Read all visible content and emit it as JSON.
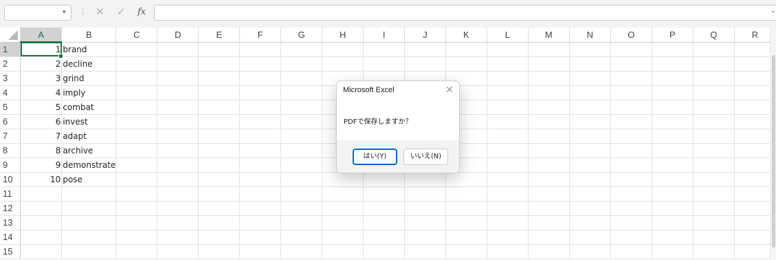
{
  "formula_bar": {
    "name_box_value": "",
    "dropdown_glyph": "▾",
    "separator_glyph": "⋮",
    "cancel_glyph": "✕",
    "enter_glyph": "✓",
    "fx_label": "fx",
    "formula_value": "",
    "expand_glyph": "⌄"
  },
  "columns": [
    "A",
    "B",
    "C",
    "D",
    "E",
    "F",
    "G",
    "H",
    "I",
    "J",
    "K",
    "L",
    "M",
    "N",
    "O",
    "P",
    "Q",
    "R"
  ],
  "rows": [
    {
      "num": "1",
      "a": "1",
      "b": "brand"
    },
    {
      "num": "2",
      "a": "2",
      "b": "decline"
    },
    {
      "num": "3",
      "a": "3",
      "b": "grind"
    },
    {
      "num": "4",
      "a": "4",
      "b": "imply"
    },
    {
      "num": "5",
      "a": "5",
      "b": "combat"
    },
    {
      "num": "6",
      "a": "6",
      "b": "invest"
    },
    {
      "num": "7",
      "a": "7",
      "b": "adapt"
    },
    {
      "num": "8",
      "a": "8",
      "b": "archive"
    },
    {
      "num": "9",
      "a": "9",
      "b": "demonstrate"
    },
    {
      "num": "10",
      "a": "10",
      "b": "pose"
    },
    {
      "num": "11",
      "a": "",
      "b": ""
    },
    {
      "num": "12",
      "a": "",
      "b": ""
    },
    {
      "num": "13",
      "a": "",
      "b": ""
    },
    {
      "num": "14",
      "a": "",
      "b": ""
    },
    {
      "num": "15",
      "a": "",
      "b": ""
    }
  ],
  "selection": {
    "column": "A",
    "row": "1"
  },
  "dialog": {
    "title": "Microsoft Excel",
    "close_glyph": "✕",
    "message": "PDFで保存しますか？",
    "yes_label": "はい(Y)",
    "no_label": "いいえ(N)"
  },
  "colors": {
    "accent": "#217346",
    "default_button_border": "#0067c0"
  }
}
